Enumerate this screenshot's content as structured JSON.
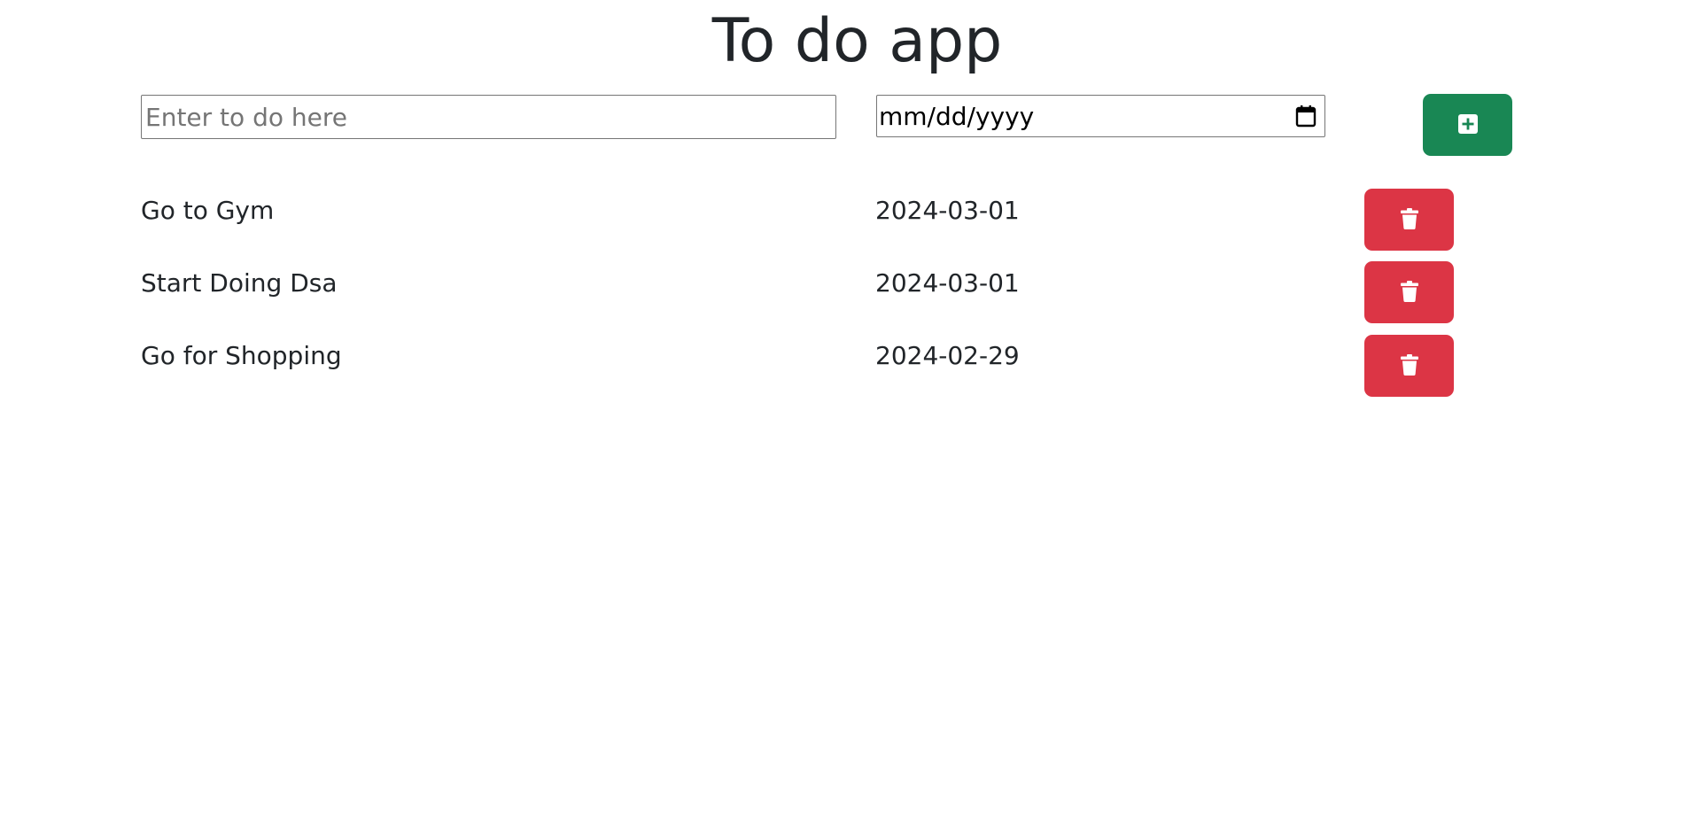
{
  "app": {
    "title": "To do app"
  },
  "form": {
    "todo_placeholder": "Enter to do here",
    "todo_value": "",
    "date_placeholder": "mm/dd/yyyy",
    "add_icon": "plus-square-icon"
  },
  "todos": [
    {
      "name": "Go to Gym",
      "date": "2024-03-01",
      "delete_icon": "trash-icon"
    },
    {
      "name": "Start Doing Dsa",
      "date": "2024-03-01",
      "delete_icon": "trash-icon"
    },
    {
      "name": "Go for Shopping",
      "date": "2024-02-29",
      "delete_icon": "trash-icon"
    }
  ],
  "colors": {
    "add_button": "#198754",
    "delete_button": "#dc3545",
    "text": "#212529"
  }
}
